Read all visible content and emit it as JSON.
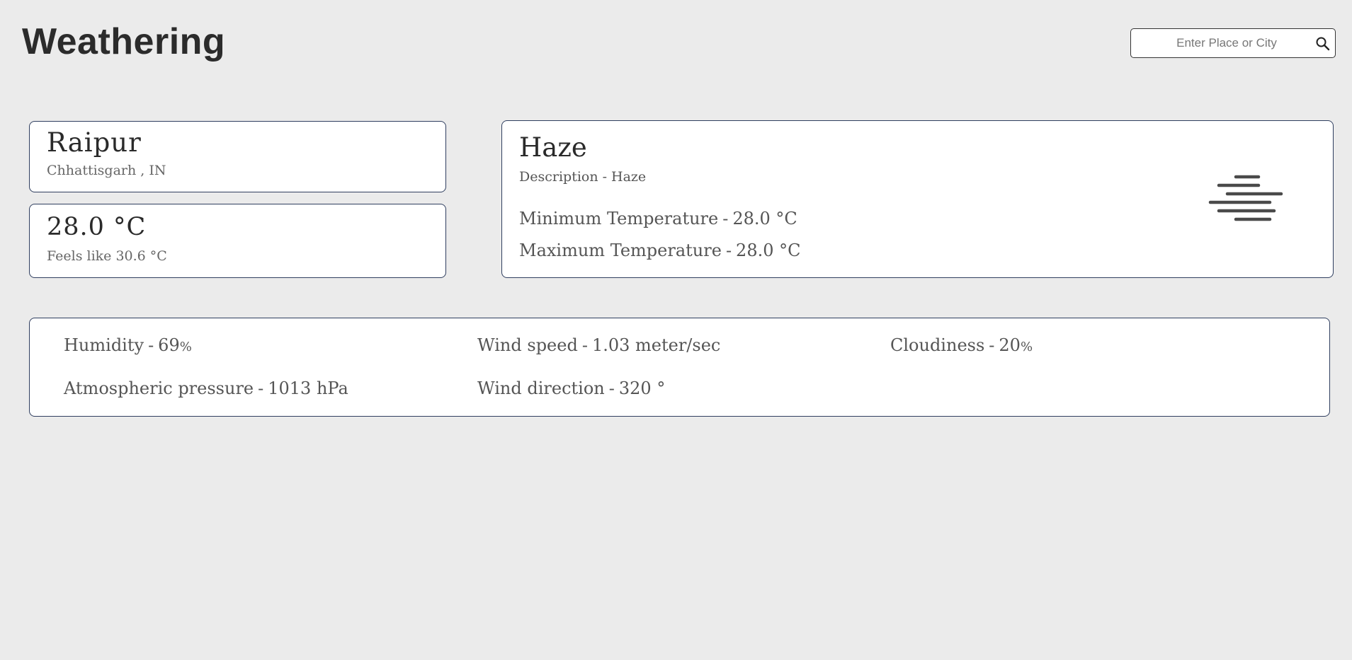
{
  "header": {
    "title": "Weathering",
    "search_placeholder": "Enter Place or City",
    "search_icon": "search-icon"
  },
  "location": {
    "city": "Raipur",
    "region": "Chhattisgarh , IN"
  },
  "temperature": {
    "value": "28.0 °C",
    "feels_like": "Feels like 30.6 °C"
  },
  "weather": {
    "main": "Haze",
    "description_label": "Description",
    "description_value": "Haze",
    "min_label": "Minimum Temperature",
    "min_value": "28.0 °C",
    "max_label": "Maximum Temperature",
    "max_value": "28.0 °C",
    "icon": "haze-icon"
  },
  "details": {
    "humidity_label": "Humidity",
    "humidity_value": "69",
    "humidity_unit": "%",
    "wind_speed_label": "Wind speed",
    "wind_speed_value": "1.03 meter/sec",
    "cloudiness_label": "Cloudiness",
    "cloudiness_value": "20",
    "cloudiness_unit": "%",
    "pressure_label": "Atmospheric pressure",
    "pressure_value": "1013 hPa",
    "wind_direction_label": "Wind direction",
    "wind_direction_value": "320 °"
  },
  "separator": "-",
  "colors": {
    "background": "#ebebeb",
    "card_border": "#2f3e5f",
    "icon": "#4a4a4a"
  }
}
